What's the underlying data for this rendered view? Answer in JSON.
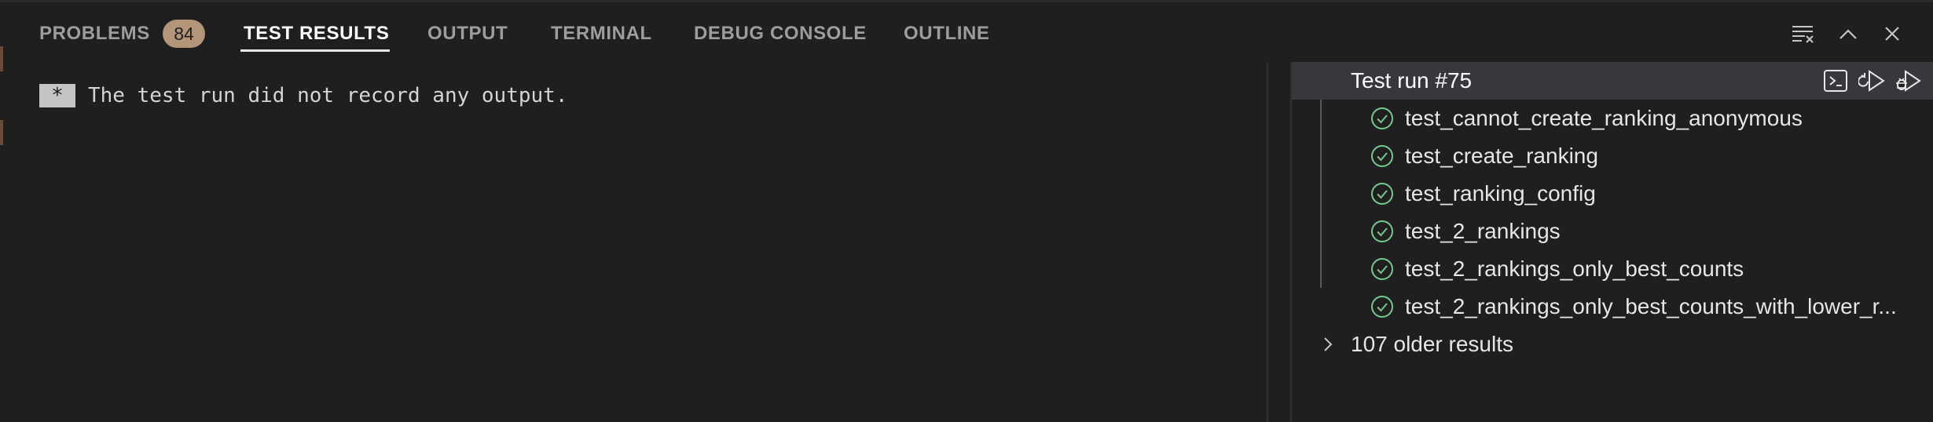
{
  "tabs": [
    {
      "label": "PROBLEMS",
      "badge": "84"
    },
    {
      "label": "TEST RESULTS",
      "active": true
    },
    {
      "label": "OUTPUT"
    },
    {
      "label": "TERMINAL"
    },
    {
      "label": "DEBUG CONSOLE"
    },
    {
      "label": "OUTLINE"
    }
  ],
  "toolbar": {
    "icons": [
      "clear-results-icon",
      "maximize-panel-icon",
      "close-panel-icon"
    ]
  },
  "output": {
    "marker": "*",
    "message": "The test run did not record any output."
  },
  "tree": {
    "run": {
      "label": "Test run #75",
      "actions": [
        "open-terminal-icon",
        "rerun-icon",
        "debug-rerun-icon"
      ]
    },
    "tests": [
      {
        "name": "test_cannot_create_ranking_anonymous",
        "status": "passed"
      },
      {
        "name": "test_create_ranking",
        "status": "passed"
      },
      {
        "name": "test_ranking_config",
        "status": "passed"
      },
      {
        "name": "test_2_rankings",
        "status": "passed"
      },
      {
        "name": "test_2_rankings_only_best_counts",
        "status": "passed"
      },
      {
        "name": "test_2_rankings_only_best_counts_with_lower_r...",
        "status": "passed"
      }
    ],
    "older": {
      "label": "107 older results"
    }
  },
  "colors": {
    "background": "#1f1f1f",
    "active_tab": "#ffffff",
    "inactive_tab": "#9d9d9d",
    "badge": "#b39679",
    "pass": "#73c991",
    "selected_row": "#37373d"
  }
}
